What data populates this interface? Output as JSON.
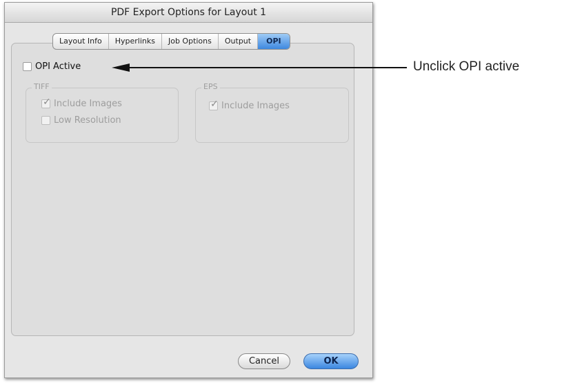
{
  "dialog": {
    "title": "PDF Export Options for Layout 1",
    "tabs": [
      {
        "label": "Layout Info",
        "active": false
      },
      {
        "label": "Hyperlinks",
        "active": false
      },
      {
        "label": "Job Options",
        "active": false
      },
      {
        "label": "Output",
        "active": false
      },
      {
        "label": "OPI",
        "active": true
      }
    ],
    "opi_active": {
      "label": "OPI Active",
      "checked": false
    },
    "tiff": {
      "title": "TIFF",
      "include_images": {
        "label": "Include Images",
        "checked": true,
        "enabled": false
      },
      "low_resolution": {
        "label": "Low Resolution",
        "checked": false,
        "enabled": false
      }
    },
    "eps": {
      "title": "EPS",
      "include_images": {
        "label": "Include Images",
        "checked": true,
        "enabled": false
      }
    },
    "buttons": {
      "cancel": "Cancel",
      "ok": "OK"
    }
  },
  "annotation": {
    "text": "Unclick OPI active"
  },
  "colors": {
    "accent": "#3e88e0",
    "disabled_text": "#9d9d9d",
    "arrow": "#111111"
  }
}
